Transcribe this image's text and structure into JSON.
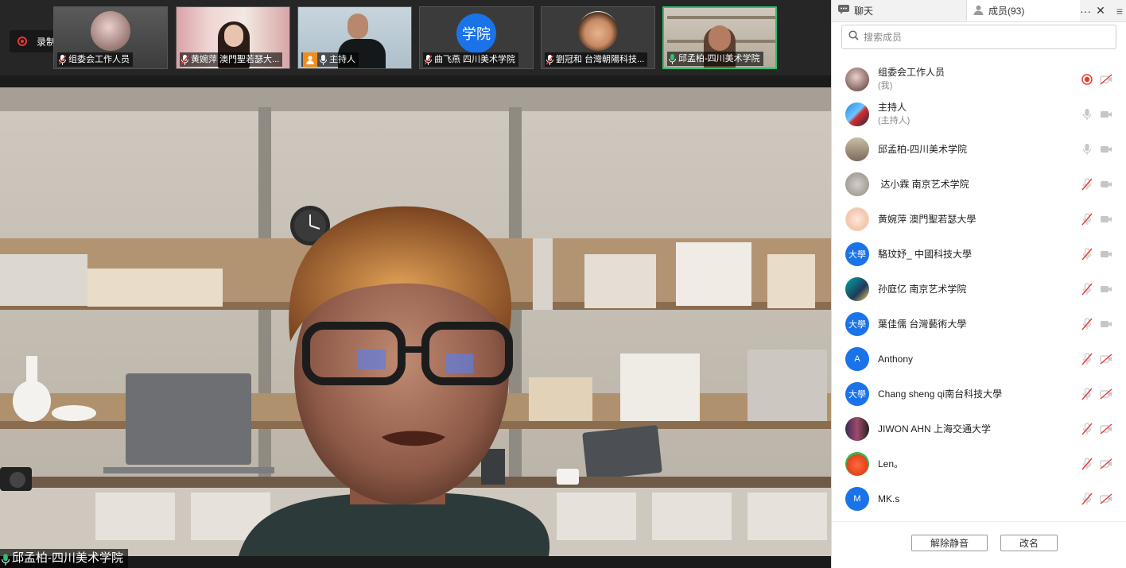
{
  "recording": {
    "label": "录制中"
  },
  "thumbnails": [
    {
      "name": "组委会工作人员",
      "mic": "muted"
    },
    {
      "name": "黄婉萍 澳門聖若瑟大...",
      "mic": "muted"
    },
    {
      "name": "主持人",
      "mic": "on",
      "host": true
    },
    {
      "name": "曲飞燕 四川美术学院",
      "mic": "muted",
      "badge": "学院"
    },
    {
      "name": "劉冠和 台灣朝陽科技...",
      "mic": "muted"
    },
    {
      "name": "邱孟柏-四川美术学院",
      "mic": "on",
      "active": true
    }
  ],
  "main_speaker": {
    "name": "邱孟柏-四川美术学院"
  },
  "panel": {
    "tab_chat": "聊天",
    "tab_members": "成员(93)",
    "more": "···",
    "close": "✕",
    "menu": "≡",
    "search_placeholder": "搜索成员",
    "members": [
      {
        "name": "组委会工作人员",
        "sub": "(我)",
        "avatar": "photo",
        "mic": "rec",
        "video": "off"
      },
      {
        "name": "主持人",
        "sub": "(主持人)",
        "avatar": "photo",
        "mic": "on",
        "video": "on"
      },
      {
        "name": "邱孟柏-四川美术学院",
        "sub": "",
        "avatar": "photo",
        "mic": "on",
        "video": "on"
      },
      {
        "name": " 达小霖 南京艺术学院",
        "sub": "",
        "avatar": "photo",
        "mic": "muted",
        "video": "on"
      },
      {
        "name": "黄婉萍 澳門聖若瑟大學",
        "sub": "",
        "avatar": "photo",
        "mic": "muted",
        "video": "on"
      },
      {
        "name": "駱玟妤_ 中國科技大學",
        "sub": "",
        "avatar": "text",
        "avatar_text": "大學",
        "mic": "muted",
        "video": "on"
      },
      {
        "name": "孙庭亿 南京艺术学院",
        "sub": "",
        "avatar": "photo",
        "mic": "muted",
        "video": "on"
      },
      {
        "name": "葉佳儒 台灣藝術大學",
        "sub": "",
        "avatar": "text",
        "avatar_text": "大學",
        "mic": "muted",
        "video": "on"
      },
      {
        "name": "Anthony",
        "sub": "",
        "avatar": "text",
        "avatar_text": "A",
        "mic": "muted",
        "video": "off"
      },
      {
        "name": "Chang sheng qi南台科技大學",
        "sub": "",
        "avatar": "text",
        "avatar_text": "大學",
        "mic": "muted",
        "video": "off"
      },
      {
        "name": "JIWON AHN 上海交通大学",
        "sub": "",
        "avatar": "photo",
        "mic": "muted",
        "video": "off"
      },
      {
        "name": "Len。",
        "sub": "",
        "avatar": "photo",
        "mic": "muted",
        "video": "off"
      },
      {
        "name": "MK.s",
        "sub": "",
        "avatar": "text",
        "avatar_text": "M",
        "mic": "muted",
        "video": "off"
      }
    ],
    "btn_unmute": "解除静音",
    "btn_rename": "改名"
  }
}
